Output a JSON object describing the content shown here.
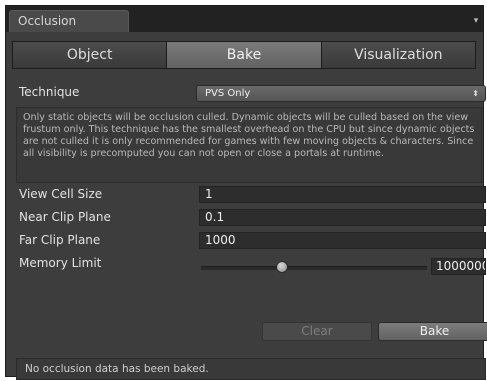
{
  "window": {
    "tab_title": "Occlusion",
    "menu_icon": "panel-menu-icon"
  },
  "toolbar": {
    "tabs": [
      {
        "label": "Object"
      },
      {
        "label": "Bake"
      },
      {
        "label": "Visualization"
      }
    ],
    "active": "Bake"
  },
  "technique": {
    "label": "Technique",
    "value": "PVS Only"
  },
  "help_text": "Only static objects will be occlusion culled. Dynamic objects will be culled based on the view frustum only. This technique has the smallest overhead on the CPU but since dynamic objects are not culled it is only recommended for games with few moving objects & characters. Since all visibility is precomputed you can not open or close a portals at runtime.",
  "fields": {
    "view_cell_size": {
      "label": "View Cell Size",
      "value": "1"
    },
    "near_clip_plane": {
      "label": "Near Clip Plane",
      "value": "0.1"
    },
    "far_clip_plane": {
      "label": "Far Clip Plane",
      "value": "1000"
    },
    "memory_limit": {
      "label": "Memory Limit",
      "value": "1000000",
      "slider_fraction": 0.36
    }
  },
  "buttons": {
    "clear": "Clear",
    "bake": "Bake"
  },
  "status": "No occlusion data has been baked."
}
